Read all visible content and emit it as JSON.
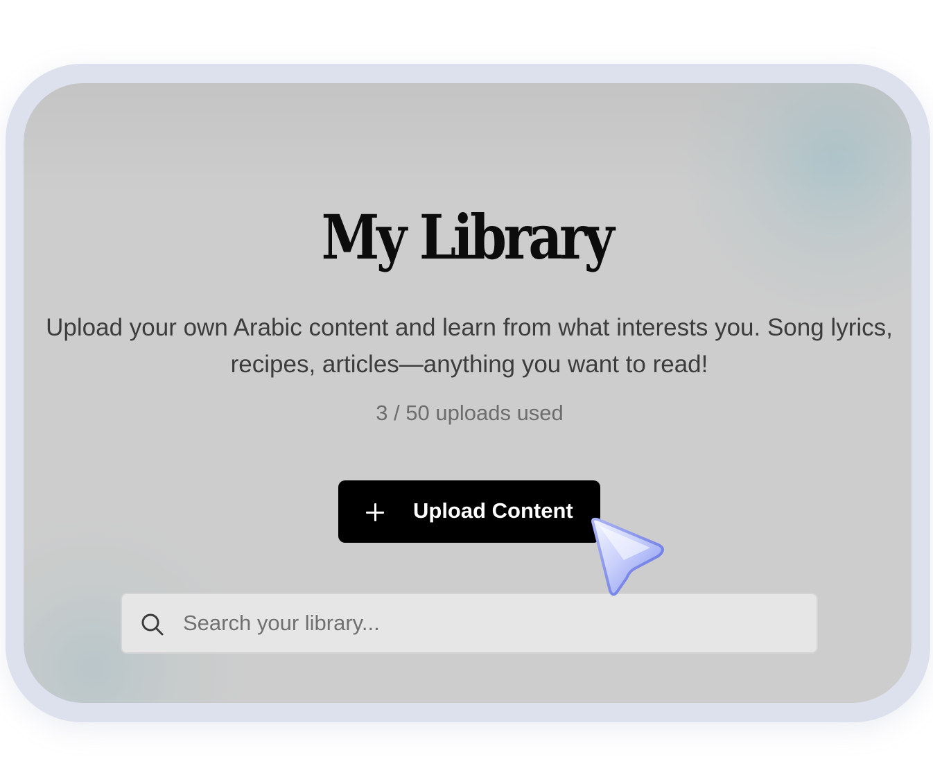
{
  "page": {
    "title": "My Library",
    "description": "Upload your own Arabic content and learn from what interests you. Song lyrics, recipes, articles—anything you want to read!",
    "usage": "3 / 50 uploads used"
  },
  "actions": {
    "upload_label": "Upload Content",
    "upload_icon": "plus-icon"
  },
  "search": {
    "placeholder": "Search your library...",
    "value": "",
    "icon": "search-icon"
  },
  "cursor": {
    "icon": "pointer-cursor-icon"
  },
  "colors": {
    "frame": "#dde1ee",
    "card_background": "#cdcdcd",
    "button_background": "#000000",
    "button_text": "#ffffff",
    "search_background": "#e6e6e6",
    "cursor_accent": "#8e9cf2"
  }
}
